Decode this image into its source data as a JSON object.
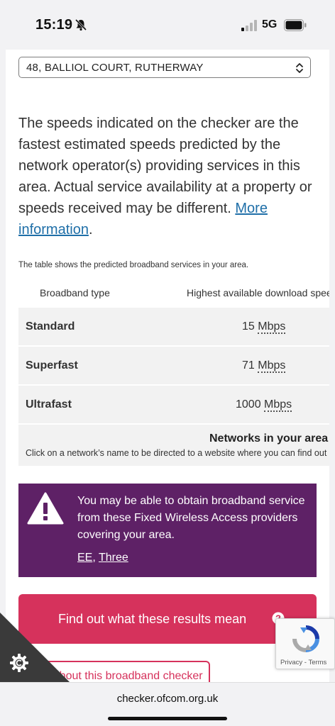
{
  "status_bar": {
    "time": "15:19",
    "network": "5G",
    "icons": [
      "bell-off-icon",
      "signal-icon",
      "battery-icon"
    ]
  },
  "address_select": {
    "value": "48, BALLIOL COURT, RUTHERWAY"
  },
  "info": {
    "text": "The speeds indicated on the checker are the fastest estimated speeds predicted by the network operator(s) providing services in this area. Actual service availability at a property or speeds received may be different. ",
    "link": "More information",
    "trailing": "."
  },
  "table": {
    "caption": "The table shows the predicted broadband services in your area.",
    "headers": [
      "Broadband type",
      "Highest available download speed"
    ],
    "rows": [
      {
        "type": "Standard",
        "value": "15",
        "unit": "Mbps"
      },
      {
        "type": "Superfast",
        "value": "71",
        "unit": "Mbps"
      },
      {
        "type": "Ultrafast",
        "value": "1000",
        "unit": "Mbps"
      }
    ]
  },
  "networks": {
    "title": "Networks in your area",
    "hint": "Click on a network’s name to be directed to a website where you can find out about"
  },
  "fwa": {
    "text": "You may be able to obtain broadband service from these Fixed Wireless Access providers covering your area.",
    "links": [
      "EE",
      "Three"
    ],
    "separator": ", ",
    "bg_color": "#5e2166"
  },
  "buttons": {
    "results": "Find out what these results mean",
    "about": "About this broadband checker",
    "accent_color": "#d6325c"
  },
  "recaptcha": {
    "privacy": "Privacy",
    "separator": " - ",
    "terms": "Terms"
  },
  "browser": {
    "url": "checker.ofcom.org.uk"
  }
}
